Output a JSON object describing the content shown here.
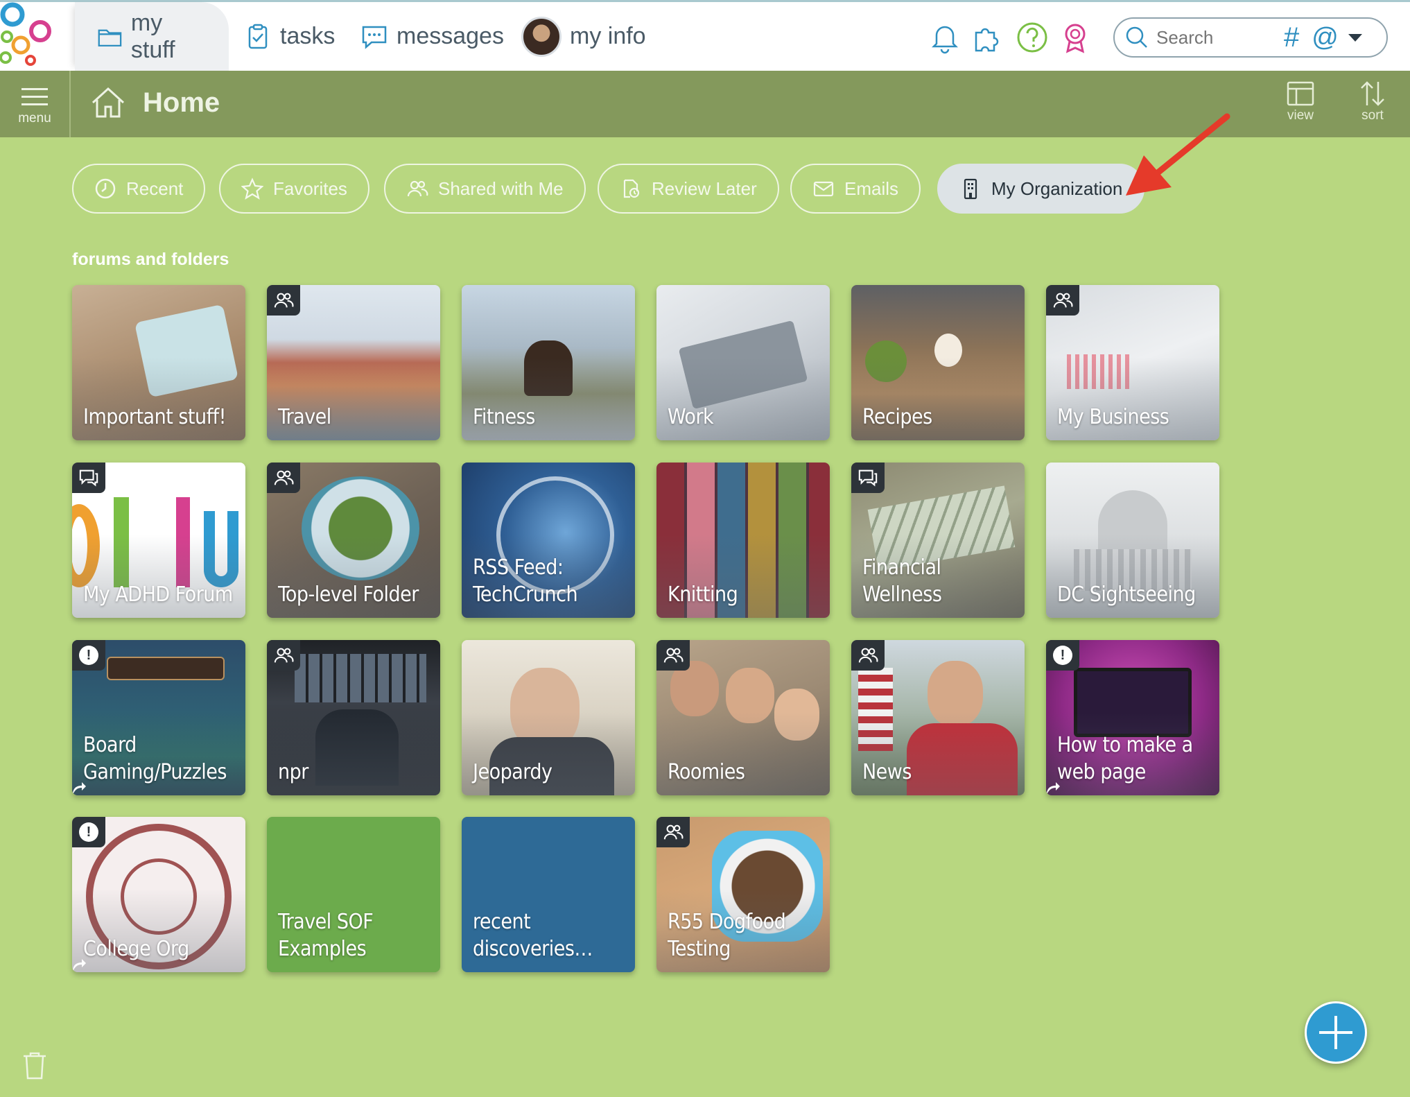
{
  "nav": {
    "tabs": [
      {
        "label": "my stuff",
        "icon": "folder-icon"
      },
      {
        "label": "tasks",
        "icon": "clipboard-check-icon"
      },
      {
        "label": "messages",
        "icon": "chat-bubble-icon"
      },
      {
        "label": "my info",
        "icon": "avatar"
      }
    ],
    "search_placeholder": "Search",
    "hash_label": "#",
    "at_label": "@"
  },
  "header": {
    "menu_label": "menu",
    "title": "Home",
    "view_label": "view",
    "sort_label": "sort"
  },
  "filters": [
    {
      "label": "Recent",
      "icon": "clock-icon"
    },
    {
      "label": "Favorites",
      "icon": "star-icon"
    },
    {
      "label": "Shared with Me",
      "icon": "users-icon"
    },
    {
      "label": "Review Later",
      "icon": "review-icon"
    },
    {
      "label": "Emails",
      "icon": "envelope-icon"
    },
    {
      "label": "My Organization",
      "icon": "building-icon",
      "active": true
    }
  ],
  "section_label": "forums and folders",
  "tiles": [
    {
      "title": "Important stuff!",
      "badge": "none"
    },
    {
      "title": "Travel",
      "badge": "group"
    },
    {
      "title": "Fitness",
      "badge": "none"
    },
    {
      "title": "Work",
      "badge": "none"
    },
    {
      "title": "Recipes",
      "badge": "none"
    },
    {
      "title": "My Business",
      "badge": "group"
    },
    {
      "title": "My ADHD Forum",
      "badge": "chat"
    },
    {
      "title": "Top-level Folder",
      "badge": "group"
    },
    {
      "title": "RSS Feed: TechCrunch",
      "badge": "none"
    },
    {
      "title": "Knitting",
      "badge": "none"
    },
    {
      "title": "Financial Wellness",
      "badge": "chat"
    },
    {
      "title": "DC Sightseeing",
      "badge": "none"
    },
    {
      "title": "Board Gaming/Puzzles",
      "badge": "alert"
    },
    {
      "title": "npr",
      "badge": "group"
    },
    {
      "title": "Jeopardy",
      "badge": "none"
    },
    {
      "title": "Roomies",
      "badge": "group"
    },
    {
      "title": "News",
      "badge": "group"
    },
    {
      "title": "How to make a web page",
      "badge": "alert"
    },
    {
      "title": "College Org",
      "badge": "alert"
    },
    {
      "title": "Travel SOF Examples",
      "badge": "none"
    },
    {
      "title": "recent discoveries…",
      "badge": "none"
    },
    {
      "title": "R55 Dogfood Testing",
      "badge": "group"
    }
  ],
  "colors": {
    "page_bg": "#b8d780",
    "header_bg": "#84995c",
    "accent_blue": "#2f9bd1",
    "annotation_red": "#e53a2a"
  }
}
